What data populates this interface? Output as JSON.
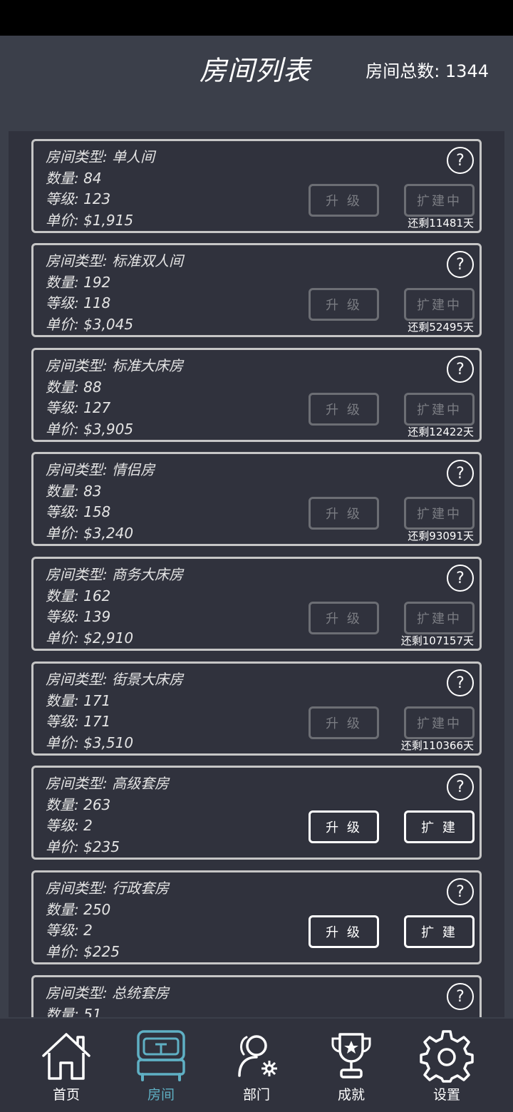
{
  "header": {
    "title": "房间列表",
    "total_label": "房间总数: 1344"
  },
  "rooms": [
    {
      "type": "房间类型: 单人间",
      "count": "数量: 84",
      "level": "等级: 123",
      "price": "单价: $1,915",
      "upgrade_label": "升 级",
      "expand_label": "扩建中",
      "remaining": "还剩11481天",
      "disabled": true
    },
    {
      "type": "房间类型: 标准双人间",
      "count": "数量: 192",
      "level": "等级: 118",
      "price": "单价: $3,045",
      "upgrade_label": "升 级",
      "expand_label": "扩建中",
      "remaining": "还剩52495天",
      "disabled": true
    },
    {
      "type": "房间类型: 标准大床房",
      "count": "数量: 88",
      "level": "等级: 127",
      "price": "单价: $3,905",
      "upgrade_label": "升 级",
      "expand_label": "扩建中",
      "remaining": "还剩12422天",
      "disabled": true
    },
    {
      "type": "房间类型: 情侣房",
      "count": "数量: 83",
      "level": "等级: 158",
      "price": "单价: $3,240",
      "upgrade_label": "升 级",
      "expand_label": "扩建中",
      "remaining": "还剩93091天",
      "disabled": true
    },
    {
      "type": "房间类型: 商务大床房",
      "count": "数量: 162",
      "level": "等级: 139",
      "price": "单价: $2,910",
      "upgrade_label": "升 级",
      "expand_label": "扩建中",
      "remaining": "还剩107157天",
      "disabled": true
    },
    {
      "type": "房间类型: 街景大床房",
      "count": "数量: 171",
      "level": "等级: 171",
      "price": "单价: $3,510",
      "upgrade_label": "升 级",
      "expand_label": "扩建中",
      "remaining": "还剩110366天",
      "disabled": true
    },
    {
      "type": "房间类型: 高级套房",
      "count": "数量: 263",
      "level": "等级: 2",
      "price": "单价: $235",
      "upgrade_label": "升 级",
      "expand_label": "扩 建",
      "remaining": "",
      "disabled": false
    },
    {
      "type": "房间类型: 行政套房",
      "count": "数量: 250",
      "level": "等级: 2",
      "price": "单价: $225",
      "upgrade_label": "升 级",
      "expand_label": "扩 建",
      "remaining": "",
      "disabled": false
    },
    {
      "type": "房间类型: 总统套房",
      "count": "数量: 51",
      "level": "",
      "price": "",
      "upgrade_label": "",
      "expand_label": "",
      "remaining": "",
      "disabled": false
    }
  ],
  "help_glyph": "?",
  "tabs": [
    {
      "label": "首页",
      "icon": "home-icon",
      "active": false
    },
    {
      "label": "房间",
      "icon": "bed-icon",
      "active": true
    },
    {
      "label": "部门",
      "icon": "department-icon",
      "active": false
    },
    {
      "label": "成就",
      "icon": "trophy-icon",
      "active": false
    },
    {
      "label": "设置",
      "icon": "gear-icon",
      "active": false
    }
  ],
  "colors": {
    "background": "#3b3f4a",
    "panel": "#30323d",
    "active_tab": "#5fb0c4",
    "disabled_button": "#6c6e74"
  }
}
